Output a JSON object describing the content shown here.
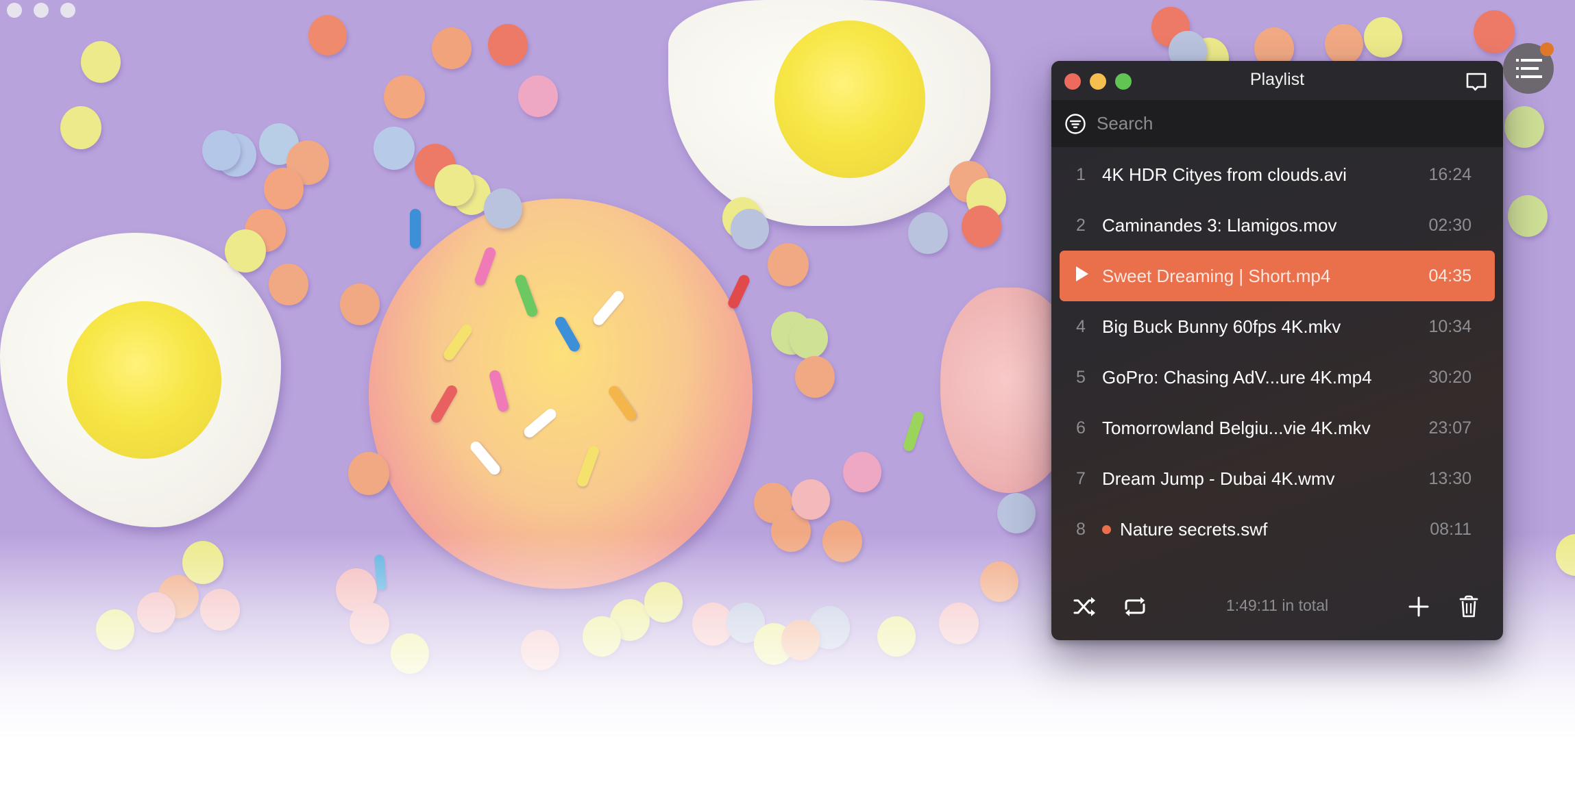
{
  "window": {
    "dots": [
      "close",
      "minimize",
      "zoom"
    ]
  },
  "playlist": {
    "title": "Playlist",
    "search": {
      "placeholder": "Search",
      "value": ""
    },
    "items": [
      {
        "index": "1",
        "name": "4K HDR Cityes from clouds.avi",
        "duration": "16:24",
        "playing": false,
        "unwatched": false
      },
      {
        "index": "2",
        "name": "Caminandes 3: Llamigos.mov",
        "duration": "02:30",
        "playing": false,
        "unwatched": false
      },
      {
        "index": "3",
        "name": "Sweet Dreaming | Short.mp4",
        "duration": "04:35",
        "playing": true,
        "unwatched": false
      },
      {
        "index": "4",
        "name": "Big Buck Bunny 60fps 4K.mkv",
        "duration": "10:34",
        "playing": false,
        "unwatched": false
      },
      {
        "index": "5",
        "name": "GoPro: Chasing AdV...ure 4K.mp4",
        "duration": "30:20",
        "playing": false,
        "unwatched": false
      },
      {
        "index": "6",
        "name": "Tomorrowland Belgiu...vie 4K.mkv",
        "duration": "23:07",
        "playing": false,
        "unwatched": false
      },
      {
        "index": "7",
        "name": "Dream Jump - Dubai 4K.wmv",
        "duration": "13:30",
        "playing": false,
        "unwatched": false
      },
      {
        "index": "8",
        "name": "Nature secrets.swf",
        "duration": "08:11",
        "playing": false,
        "unwatched": true
      }
    ],
    "footer": {
      "total": "1:49:11 in total",
      "buttons": [
        "shuffle-icon",
        "repeat-icon",
        "plus-icon",
        "trash-icon"
      ]
    }
  },
  "icons": {
    "chat": "chat-bubble-icon",
    "filter": "filter-icon",
    "play": "play-icon",
    "playlist_toggle": "list-icon"
  },
  "colors": {
    "accent": "#e9704b",
    "badge": "#e0782a",
    "panel_bg": "#2c2a2e",
    "traffic_close": "#ed6a5e",
    "traffic_min": "#f5bf4f",
    "traffic_max": "#61c554"
  }
}
